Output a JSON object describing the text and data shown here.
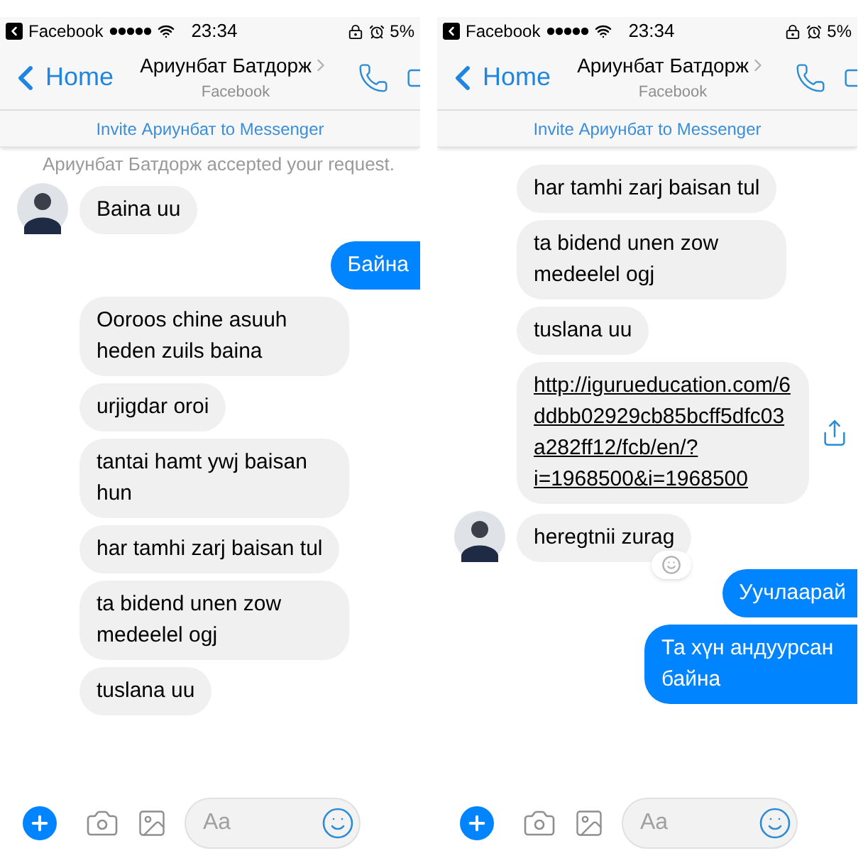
{
  "panes": [
    {
      "status_bar": {
        "app": "Facebook",
        "time": "23:34",
        "battery": "5%"
      },
      "header": {
        "back": "Home",
        "title": "Ариунбат Батдорж",
        "subtitle": "Facebook"
      },
      "invite": "Invite Ариунбат to Messenger",
      "messages": [
        {
          "kind": "system",
          "text": "Ариунбат Батдорж accepted your request."
        },
        {
          "kind": "incoming",
          "text": "Baina uu",
          "avatar": true,
          "reaction": false
        },
        {
          "kind": "outgoing",
          "text": "Байна"
        },
        {
          "kind": "incoming",
          "text": "Ooroos chine asuuh heden zuils baina",
          "avatar": false,
          "reaction": false
        },
        {
          "kind": "incoming",
          "text": "urjigdar oroi",
          "avatar": false,
          "reaction": false
        },
        {
          "kind": "incoming",
          "text": "tantai hamt ywj baisan hun",
          "avatar": false,
          "reaction": false
        },
        {
          "kind": "incoming",
          "text": "har tamhi zarj baisan tul",
          "avatar": false,
          "reaction": false
        },
        {
          "kind": "incoming",
          "text": "ta bidend unen zow medeelel ogj",
          "avatar": false,
          "reaction": false
        },
        {
          "kind": "incoming",
          "text": "tuslana uu",
          "avatar": false,
          "reaction": false
        }
      ],
      "composer": {
        "placeholder": "Aa"
      }
    },
    {
      "status_bar": {
        "app": "Facebook",
        "time": "23:34",
        "battery": "5%"
      },
      "header": {
        "back": "Home",
        "title": "Ариунбат Батдорж",
        "subtitle": "Facebook"
      },
      "invite": "Invite Ариунбат to Messenger",
      "messages": [
        {
          "kind": "incoming",
          "text": "har tamhi zarj baisan tul",
          "avatar": false,
          "reaction": false
        },
        {
          "kind": "incoming",
          "text": "ta bidend unen zow medeelel ogj",
          "avatar": false,
          "reaction": false
        },
        {
          "kind": "incoming",
          "text": "tuslana uu",
          "avatar": false,
          "reaction": false
        },
        {
          "kind": "link",
          "text": "http://igurueducation.com/6ddbb02929cb85bcff5dfc03a282ff12/fcb/en/?i=1968500&i=1968500"
        },
        {
          "kind": "incoming",
          "text": "heregtnii zurag",
          "avatar": true,
          "reaction": true
        },
        {
          "kind": "outgoing",
          "text": "Уучлаарай"
        },
        {
          "kind": "outgoing",
          "text": "Та хүн андуурсан байна"
        }
      ],
      "composer": {
        "placeholder": "Aa"
      }
    }
  ]
}
